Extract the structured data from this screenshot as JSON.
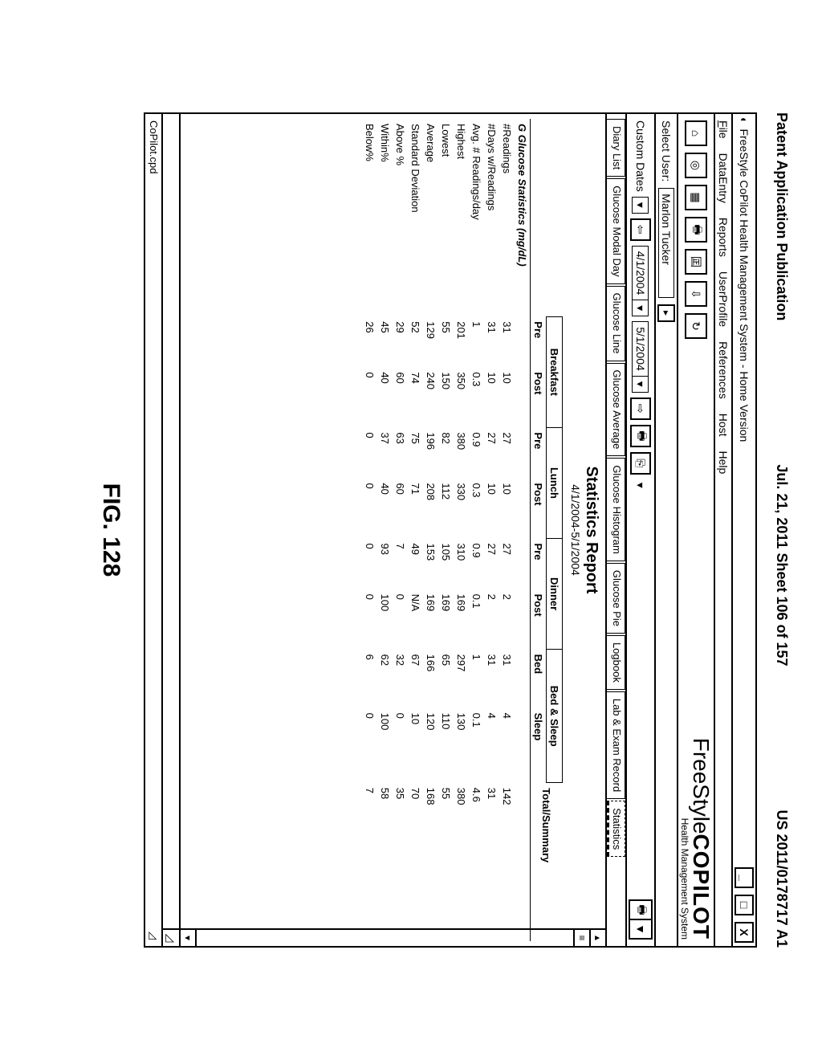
{
  "pub": {
    "left": "Patent Application Publication",
    "center": "Jul. 21, 2011  Sheet 106 of 157",
    "right": "US 2011/0178717 A1"
  },
  "window": {
    "title": "FreeStyle CoPilot Health Management System - Home Version",
    "minimize": "_",
    "maximize": "□",
    "close": "X"
  },
  "menu": {
    "file": "File",
    "dataentry": "DataEntry",
    "reports": "Reports",
    "userprofile": "UserProfile",
    "references": "References",
    "host": "Host",
    "help": "Help"
  },
  "brand": {
    "line1a": "FreeStyle",
    "line1b": "COPILOT",
    "line2": "Health Management System"
  },
  "userbar": {
    "label": "Select User:",
    "value": "Marlon Tucker"
  },
  "daterow": {
    "label": "Custom Dates",
    "from": "4/1/2004",
    "to": "5/1/2004"
  },
  "tabs": [
    "Diary List",
    "Glucose Modal Day",
    "Glucose Line",
    "Glucose Average",
    "Glucose Histogram",
    "Glucose Pie",
    "Logbook",
    "Lab & Exam Record",
    "Statistics"
  ],
  "report": {
    "title": "Statistics Report",
    "range": "4/1/2004-5/1/2004",
    "section": "G Glucose Statistics (mg/dL)",
    "groups": [
      "Breakfast",
      "Lunch",
      "Dinner",
      "Bed & Sleep"
    ],
    "cols": [
      "Pre",
      "Post",
      "Pre",
      "Post",
      "Pre",
      "Post",
      "Bed",
      "Sleep",
      "Total/Summary"
    ]
  },
  "chart_data": {
    "type": "table",
    "title": "Statistics Report 4/1/2004-5/1/2004 — Glucose Statistics (mg/dL)",
    "columns": [
      "Metric",
      "Breakfast Pre",
      "Breakfast Post",
      "Lunch Pre",
      "Lunch Post",
      "Dinner Pre",
      "Dinner Post",
      "Bed",
      "Sleep",
      "Total/Summary"
    ],
    "rows": [
      [
        "#Readings",
        31,
        10,
        27,
        10,
        27,
        2,
        31,
        4,
        142
      ],
      [
        "#Days w/Readings",
        31,
        10,
        27,
        10,
        27,
        2,
        31,
        4,
        31
      ],
      [
        "Avg. # Readings/day",
        1.0,
        0.3,
        0.9,
        0.3,
        0.9,
        0.1,
        1.0,
        0.1,
        4.6
      ],
      [
        "Highest",
        201,
        350,
        380,
        330,
        310,
        169,
        297,
        130,
        380
      ],
      [
        "Lowest",
        55,
        150,
        82,
        112,
        105,
        169,
        65,
        110,
        55
      ],
      [
        "Average",
        129,
        240,
        196,
        208,
        153,
        169,
        166,
        120,
        168
      ],
      [
        "Standard Deviation",
        52,
        74,
        75,
        71,
        49,
        "N/A",
        67,
        10,
        70
      ],
      [
        "Above %",
        29,
        60,
        63,
        60,
        7,
        0,
        32,
        0,
        35
      ],
      [
        "Within%",
        45,
        40,
        37,
        40,
        93,
        100,
        62,
        100,
        58
      ],
      [
        "Below%",
        26,
        0,
        0,
        0,
        0,
        0,
        6,
        0,
        7
      ]
    ]
  },
  "status": "CoPilot.cpd",
  "figure": "FIG. 128"
}
